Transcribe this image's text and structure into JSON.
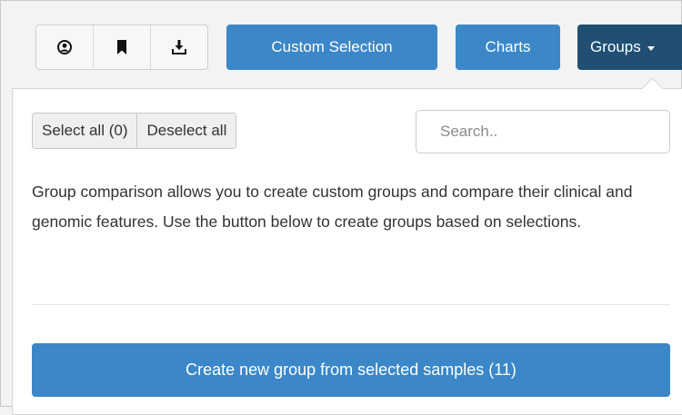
{
  "toolbar": {
    "icons": [
      "user-circle-icon",
      "bookmark-icon",
      "download-icon"
    ],
    "custom_selection_label": "Custom Selection",
    "charts_label": "Charts",
    "groups_label": "Groups"
  },
  "panel": {
    "select_all_label": "Select all (0)",
    "deselect_all_label": "Deselect all",
    "search_placeholder": "Search..",
    "description": "Group comparison allows you to create custom groups and compare their clinical and genomic features. Use the button below to create groups based on selections.",
    "create_button_label": "Create new group from selected samples (11)"
  },
  "colors": {
    "primary": "#3b87c7",
    "active": "#204f73"
  }
}
